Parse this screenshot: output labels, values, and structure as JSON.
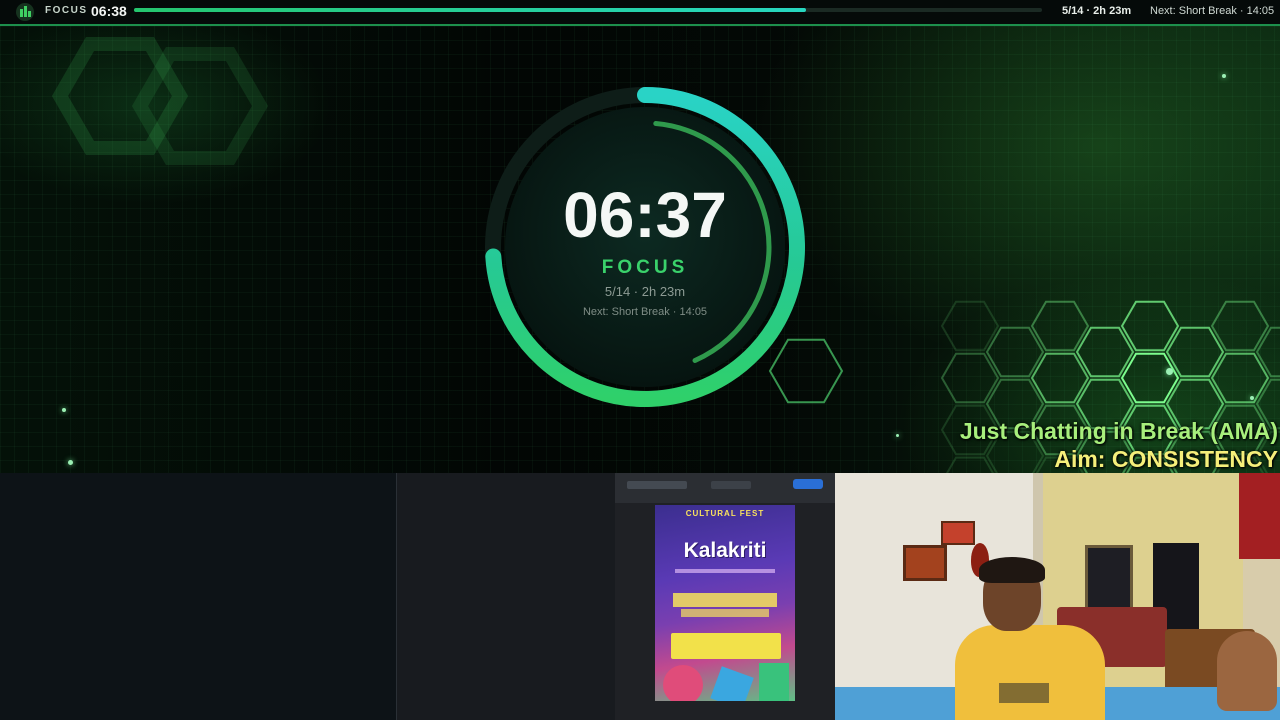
{
  "topbar": {
    "mode_label": "FOCUS",
    "time": "06:38",
    "progress_fraction": 0.74,
    "session_info": "5/14 · 2h 23m",
    "next_info": "Next: Short Break · 14:05"
  },
  "timer": {
    "time": "06:37",
    "mode": "FOCUS",
    "session": "5/14 · 2h 23m",
    "next": "Next: Short Break · 14:05",
    "progress_fraction": 0.74
  },
  "overlay": {
    "chat_line": "Just Chatting in Break (AMA)",
    "aim_line": "Aim: CONSISTENCY"
  },
  "poster": {
    "fest_label": "CULTURAL FEST",
    "title": "Kalakriti"
  },
  "colors": {
    "accent_green": "#3ad26b",
    "accent_teal": "#27d7c0",
    "chat_text": "#a8ef7c",
    "aim_text": "#f5ef7a"
  },
  "icons": {
    "app_logo": "bar-chart-logo-icon"
  }
}
